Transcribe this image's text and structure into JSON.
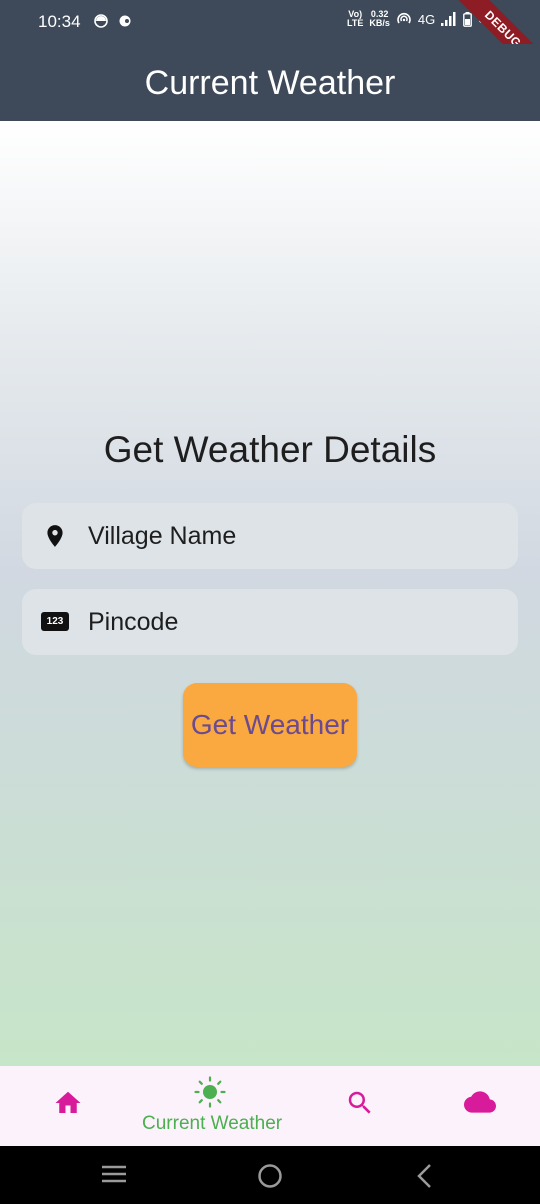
{
  "status_bar": {
    "time": "10:34",
    "net_top": "Vo)",
    "net_bottom": "LTE",
    "speed_top": "0.32",
    "speed_bottom": "KB/s",
    "network": "4G",
    "battery": "51"
  },
  "debug_banner": "DEBUG",
  "app_bar": {
    "title": "Current Weather"
  },
  "form": {
    "heading": "Get Weather Details",
    "village": {
      "placeholder": "Village Name",
      "icon": "location-pin-icon"
    },
    "pincode": {
      "placeholder": "Pincode",
      "icon_text": "123"
    },
    "submit_label": "Get Weather"
  },
  "bottom_nav": {
    "items": [
      {
        "icon": "home-icon",
        "label": ""
      },
      {
        "icon": "sun-icon",
        "label": "Current Weather"
      },
      {
        "icon": "search-icon",
        "label": ""
      },
      {
        "icon": "cloud-icon",
        "label": ""
      }
    ],
    "active_index": 1
  },
  "colors": {
    "app_bar": "#3e4a5a",
    "button_bg": "#f9a940",
    "button_text": "#6b4a8f",
    "nav_icon": "#d81b9a",
    "nav_active": "#4caf50",
    "nav_bg": "#fcf2fb"
  }
}
